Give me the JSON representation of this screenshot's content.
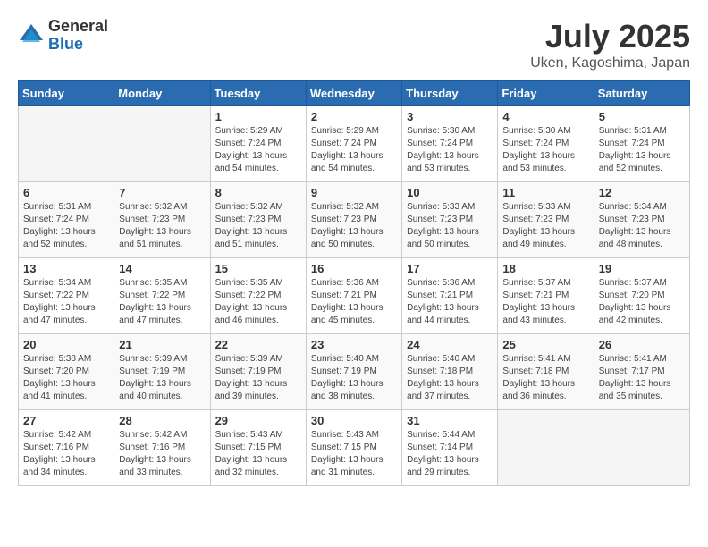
{
  "header": {
    "logo_general": "General",
    "logo_blue": "Blue",
    "title": "July 2025",
    "subtitle": "Uken, Kagoshima, Japan"
  },
  "days_of_week": [
    "Sunday",
    "Monday",
    "Tuesday",
    "Wednesday",
    "Thursday",
    "Friday",
    "Saturday"
  ],
  "weeks": [
    [
      {
        "day": "",
        "info": ""
      },
      {
        "day": "",
        "info": ""
      },
      {
        "day": "1",
        "info": "Sunrise: 5:29 AM\nSunset: 7:24 PM\nDaylight: 13 hours and 54 minutes."
      },
      {
        "day": "2",
        "info": "Sunrise: 5:29 AM\nSunset: 7:24 PM\nDaylight: 13 hours and 54 minutes."
      },
      {
        "day": "3",
        "info": "Sunrise: 5:30 AM\nSunset: 7:24 PM\nDaylight: 13 hours and 53 minutes."
      },
      {
        "day": "4",
        "info": "Sunrise: 5:30 AM\nSunset: 7:24 PM\nDaylight: 13 hours and 53 minutes."
      },
      {
        "day": "5",
        "info": "Sunrise: 5:31 AM\nSunset: 7:24 PM\nDaylight: 13 hours and 52 minutes."
      }
    ],
    [
      {
        "day": "6",
        "info": "Sunrise: 5:31 AM\nSunset: 7:24 PM\nDaylight: 13 hours and 52 minutes."
      },
      {
        "day": "7",
        "info": "Sunrise: 5:32 AM\nSunset: 7:23 PM\nDaylight: 13 hours and 51 minutes."
      },
      {
        "day": "8",
        "info": "Sunrise: 5:32 AM\nSunset: 7:23 PM\nDaylight: 13 hours and 51 minutes."
      },
      {
        "day": "9",
        "info": "Sunrise: 5:32 AM\nSunset: 7:23 PM\nDaylight: 13 hours and 50 minutes."
      },
      {
        "day": "10",
        "info": "Sunrise: 5:33 AM\nSunset: 7:23 PM\nDaylight: 13 hours and 50 minutes."
      },
      {
        "day": "11",
        "info": "Sunrise: 5:33 AM\nSunset: 7:23 PM\nDaylight: 13 hours and 49 minutes."
      },
      {
        "day": "12",
        "info": "Sunrise: 5:34 AM\nSunset: 7:23 PM\nDaylight: 13 hours and 48 minutes."
      }
    ],
    [
      {
        "day": "13",
        "info": "Sunrise: 5:34 AM\nSunset: 7:22 PM\nDaylight: 13 hours and 47 minutes."
      },
      {
        "day": "14",
        "info": "Sunrise: 5:35 AM\nSunset: 7:22 PM\nDaylight: 13 hours and 47 minutes."
      },
      {
        "day": "15",
        "info": "Sunrise: 5:35 AM\nSunset: 7:22 PM\nDaylight: 13 hours and 46 minutes."
      },
      {
        "day": "16",
        "info": "Sunrise: 5:36 AM\nSunset: 7:21 PM\nDaylight: 13 hours and 45 minutes."
      },
      {
        "day": "17",
        "info": "Sunrise: 5:36 AM\nSunset: 7:21 PM\nDaylight: 13 hours and 44 minutes."
      },
      {
        "day": "18",
        "info": "Sunrise: 5:37 AM\nSunset: 7:21 PM\nDaylight: 13 hours and 43 minutes."
      },
      {
        "day": "19",
        "info": "Sunrise: 5:37 AM\nSunset: 7:20 PM\nDaylight: 13 hours and 42 minutes."
      }
    ],
    [
      {
        "day": "20",
        "info": "Sunrise: 5:38 AM\nSunset: 7:20 PM\nDaylight: 13 hours and 41 minutes."
      },
      {
        "day": "21",
        "info": "Sunrise: 5:39 AM\nSunset: 7:19 PM\nDaylight: 13 hours and 40 minutes."
      },
      {
        "day": "22",
        "info": "Sunrise: 5:39 AM\nSunset: 7:19 PM\nDaylight: 13 hours and 39 minutes."
      },
      {
        "day": "23",
        "info": "Sunrise: 5:40 AM\nSunset: 7:19 PM\nDaylight: 13 hours and 38 minutes."
      },
      {
        "day": "24",
        "info": "Sunrise: 5:40 AM\nSunset: 7:18 PM\nDaylight: 13 hours and 37 minutes."
      },
      {
        "day": "25",
        "info": "Sunrise: 5:41 AM\nSunset: 7:18 PM\nDaylight: 13 hours and 36 minutes."
      },
      {
        "day": "26",
        "info": "Sunrise: 5:41 AM\nSunset: 7:17 PM\nDaylight: 13 hours and 35 minutes."
      }
    ],
    [
      {
        "day": "27",
        "info": "Sunrise: 5:42 AM\nSunset: 7:16 PM\nDaylight: 13 hours and 34 minutes."
      },
      {
        "day": "28",
        "info": "Sunrise: 5:42 AM\nSunset: 7:16 PM\nDaylight: 13 hours and 33 minutes."
      },
      {
        "day": "29",
        "info": "Sunrise: 5:43 AM\nSunset: 7:15 PM\nDaylight: 13 hours and 32 minutes."
      },
      {
        "day": "30",
        "info": "Sunrise: 5:43 AM\nSunset: 7:15 PM\nDaylight: 13 hours and 31 minutes."
      },
      {
        "day": "31",
        "info": "Sunrise: 5:44 AM\nSunset: 7:14 PM\nDaylight: 13 hours and 29 minutes."
      },
      {
        "day": "",
        "info": ""
      },
      {
        "day": "",
        "info": ""
      }
    ]
  ]
}
